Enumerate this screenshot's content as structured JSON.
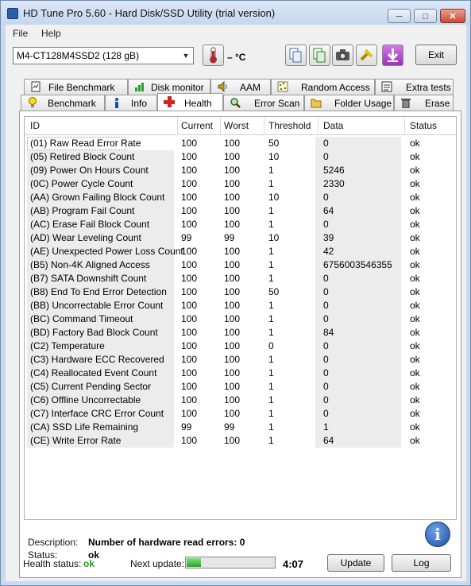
{
  "window": {
    "title": "HD Tune Pro 5.60 - Hard Disk/SSD Utility (trial version)"
  },
  "menu": {
    "file": "File",
    "help": "Help"
  },
  "toolbar": {
    "drive": "M4-CT128M4SSD2 (128 gB)",
    "temperature": "– °C",
    "exit_label": "Exit"
  },
  "tabs_row1": [
    "File Benchmark",
    "Disk monitor",
    "AAM",
    "Random Access",
    "Extra tests"
  ],
  "tabs_row2": [
    "Benchmark",
    "Info",
    "Health",
    "Error Scan",
    "Folder Usage",
    "Erase"
  ],
  "active_tab": "Health",
  "table": {
    "columns": [
      "ID",
      "Current",
      "Worst",
      "Threshold",
      "Data",
      "Status"
    ],
    "rows": [
      [
        "(01) Raw Read Error Rate",
        "100",
        "100",
        "50",
        "0",
        "ok"
      ],
      [
        "(05) Retired Block Count",
        "100",
        "100",
        "10",
        "0",
        "ok"
      ],
      [
        "(09) Power On Hours Count",
        "100",
        "100",
        "1",
        "5246",
        "ok"
      ],
      [
        "(0C) Power Cycle Count",
        "100",
        "100",
        "1",
        "2330",
        "ok"
      ],
      [
        "(AA) Grown Failing Block Count",
        "100",
        "100",
        "10",
        "0",
        "ok"
      ],
      [
        "(AB) Program Fail Count",
        "100",
        "100",
        "1",
        "64",
        "ok"
      ],
      [
        "(AC) Erase Fail Block Count",
        "100",
        "100",
        "1",
        "0",
        "ok"
      ],
      [
        "(AD) Wear Leveling Count",
        "99",
        "99",
        "10",
        "39",
        "ok"
      ],
      [
        "(AE) Unexpected Power Loss Count",
        "100",
        "100",
        "1",
        "42",
        "ok"
      ],
      [
        "(B5) Non-4K Aligned Access",
        "100",
        "100",
        "1",
        "6756003546355",
        "ok"
      ],
      [
        "(B7) SATA Downshift Count",
        "100",
        "100",
        "1",
        "0",
        "ok"
      ],
      [
        "(B8) End To End Error Detection",
        "100",
        "100",
        "50",
        "0",
        "ok"
      ],
      [
        "(BB) Uncorrectable Error Count",
        "100",
        "100",
        "1",
        "0",
        "ok"
      ],
      [
        "(BC) Command Timeout",
        "100",
        "100",
        "1",
        "0",
        "ok"
      ],
      [
        "(BD) Factory Bad Block Count",
        "100",
        "100",
        "1",
        "84",
        "ok"
      ],
      [
        "(C2) Temperature",
        "100",
        "100",
        "0",
        "0",
        "ok"
      ],
      [
        "(C3) Hardware ECC Recovered",
        "100",
        "100",
        "1",
        "0",
        "ok"
      ],
      [
        "(C4) Reallocated Event Count",
        "100",
        "100",
        "1",
        "0",
        "ok"
      ],
      [
        "(C5) Current Pending Sector",
        "100",
        "100",
        "1",
        "0",
        "ok"
      ],
      [
        "(C6) Offline Uncorrectable",
        "100",
        "100",
        "1",
        "0",
        "ok"
      ],
      [
        "(C7) Interface CRC Error Count",
        "100",
        "100",
        "1",
        "0",
        "ok"
      ],
      [
        "(CA) SSD Life Remaining",
        "99",
        "99",
        "1",
        "1",
        "ok"
      ],
      [
        "(CE) Write Error Rate",
        "100",
        "100",
        "1",
        "64",
        "ok"
      ]
    ]
  },
  "description": {
    "label": "Description:",
    "value": "Number of hardware read errors: 0",
    "status_label": "Status:",
    "status_value": "ok"
  },
  "footer": {
    "health_label": "Health status:",
    "health_value": "ok",
    "next_update_label": "Next update:",
    "progress_fraction": 0.16,
    "countdown": "4:07",
    "update_label": "Update",
    "log_label": "Log"
  },
  "colors": {
    "ok_green": "#1aa01a",
    "accent_blue": "#2a5fa8"
  }
}
